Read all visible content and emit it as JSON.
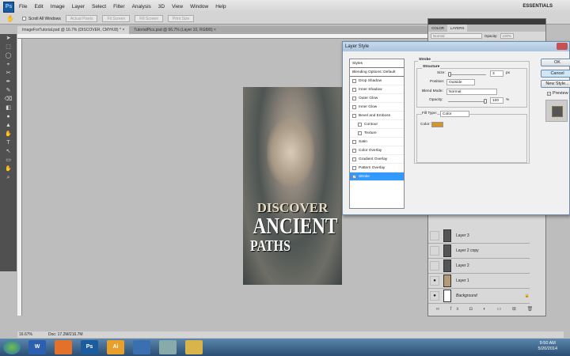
{
  "app": {
    "logo": "Ps",
    "menus": [
      "File",
      "Edit",
      "Image",
      "Layer",
      "Select",
      "Filter",
      "Analysis",
      "3D",
      "View",
      "Window",
      "Help"
    ],
    "workspace": "ESSENTIALS"
  },
  "options": {
    "scroll_all": "Scroll All Windows",
    "buttons": [
      "Actual Pixels",
      "Fit Screen",
      "Fill Screen",
      "Print Size"
    ]
  },
  "tabs": [
    {
      "label": "ImageForTutorial.psd @ 16.7% (DISCOVER, CMYK/8) *  ×"
    },
    {
      "label": "TutorialPics.psd @ 66.7% (Layer 10, RGB/8)  ×"
    }
  ],
  "canvas": {
    "line1": "DISCOVER",
    "line2": "ANCIENT",
    "line3": "PATHS"
  },
  "status": {
    "zoom": "16.67%",
    "doc": "Doc: 17.2M/216.7M"
  },
  "layers_panel": {
    "tabs": [
      "COLOR",
      "LAYERS"
    ],
    "blend": "Normal",
    "opacity_label": "Opacity:",
    "opacity": "100%",
    "rows": [
      {
        "name": "Layer 3",
        "visible": false
      },
      {
        "name": "Layer 2 copy",
        "visible": false
      },
      {
        "name": "Layer 2",
        "visible": false
      },
      {
        "name": "Layer 1",
        "visible": true
      },
      {
        "name": "Background",
        "visible": true,
        "locked": true
      }
    ]
  },
  "dialog": {
    "title": "Layer Style",
    "styles": [
      {
        "label": "Styles",
        "hdr": true
      },
      {
        "label": "Blending Options: Default",
        "hdr": true
      },
      {
        "label": "Drop Shadow"
      },
      {
        "label": "Inner Shadow"
      },
      {
        "label": "Outer Glow"
      },
      {
        "label": "Inner Glow"
      },
      {
        "label": "Bevel and Emboss"
      },
      {
        "label": "Contour",
        "indent": true
      },
      {
        "label": "Texture",
        "indent": true
      },
      {
        "label": "Satin"
      },
      {
        "label": "Color Overlay"
      },
      {
        "label": "Gradient Overlay"
      },
      {
        "label": "Pattern Overlay"
      },
      {
        "label": "Stroke",
        "checked": true,
        "selected": true
      }
    ],
    "section": "Stroke",
    "structure": "Structure",
    "size_label": "Size:",
    "size": "3",
    "size_unit": "px",
    "position_label": "Position:",
    "position": "Outside",
    "blend_label": "Blend Mode:",
    "blend": "Normal",
    "opacity_label": "Opacity:",
    "opacity": "100",
    "opacity_unit": "%",
    "fill_type_label": "Fill Type:",
    "fill_type": "Color",
    "color_label": "Color:",
    "stroke_color": "#d4952e",
    "ok": "OK",
    "cancel": "Cancel",
    "new_style": "New Style...",
    "preview": "Preview"
  },
  "taskbar": {
    "apps": [
      "W",
      "",
      "Ps",
      "Ai",
      "",
      "",
      ""
    ],
    "time": "9:50 AM",
    "date": "5/20/2014"
  }
}
